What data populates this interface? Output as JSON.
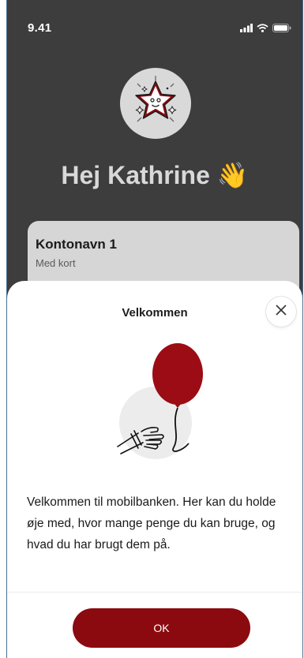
{
  "status_bar": {
    "time": "9.41",
    "icons": [
      "signal-icon",
      "wifi-icon",
      "battery-icon"
    ]
  },
  "header": {
    "avatar_icon": "star-face-icon",
    "greeting": "Hej Kathrine",
    "greeting_emoji": "👋"
  },
  "account": {
    "name": "Kontonavn 1",
    "subtitle": "Med kort"
  },
  "welcome_sheet": {
    "title": "Velkommen",
    "close_icon": "close-icon",
    "illustration_icon": "hand-releasing-balloon-icon",
    "body": "Velkommen til mobilbanken. Her kan du holde øje med, hvor mange penge du kan bruge, og hvad du har brugt dem på.",
    "ok_label": "OK"
  },
  "colors": {
    "background_dark": "#3d3d3d",
    "card_gray": "#d6d6d6",
    "brand_red": "#8b0a0f",
    "balloon_red": "#9b0c14"
  }
}
